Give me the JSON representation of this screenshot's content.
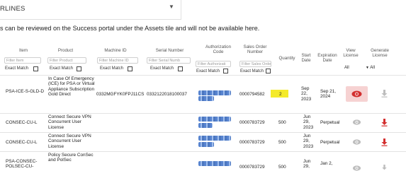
{
  "top_select": {
    "value": "RLINES"
  },
  "notice": "s can be reviewed on the Success portal under the Assets tile and will not be available here.",
  "columns": {
    "item": "Item",
    "product": "Product",
    "machine_id": "Machine ID",
    "serial_number": "Serial Number",
    "authorization_code": "Authorization Code",
    "sales_order_number": "Sales Order Number",
    "quantity": "Quantity",
    "start_date": "Start Date",
    "expiration_date": "Expiration Date",
    "view_license": "View License",
    "generate_license": "Generate License"
  },
  "filters": {
    "item_placeholder": "Filter Item",
    "product_placeholder": "Filter Product",
    "machine_id_placeholder": "Filter Machine ID",
    "serial_number_placeholder": "Filter Serial Numb",
    "authorization_placeholder": "Filter Authorizati",
    "sales_order_placeholder": "Filter Sales Order",
    "exact_match": "Exact Match",
    "view_select": "All",
    "generate_select": "All"
  },
  "rows": [
    {
      "item": "PSA-ICE-S-GLD-D",
      "product": "In Case Of Emergency (ICE) for PSA or Virtual Appliance Subscription Gold Direct",
      "machine_id": "0332MGFYK0FPJ11CS",
      "serial_number": "0332122018100037",
      "sales_order": "0000794582",
      "quantity": "2",
      "start_date": "Sep 22, 2023",
      "expiration_date": "Sep 21, 2024"
    },
    {
      "item": "CONSEC-CU-L",
      "product": "Connect Secure VPN Concurrent User License",
      "machine_id": "",
      "serial_number": "",
      "sales_order": "0000783729",
      "quantity": "500",
      "start_date": "Jun 29, 2023",
      "expiration_date": "Perpetual"
    },
    {
      "item": "CONSEC-CU-L",
      "product": "Connect Secure VPN Concurrent User License",
      "machine_id": "",
      "serial_number": "",
      "sales_order": "0000783729",
      "quantity": "500",
      "start_date": "Jun 29, 2023",
      "expiration_date": "Perpetual"
    },
    {
      "item": "PSA-CONSEC-POLSEC-CU-",
      "product": "Policy Secure ConSec and PolSec",
      "machine_id": "",
      "serial_number": "",
      "sales_order": "0000783729",
      "quantity": "500",
      "start_date": "Jun 29,",
      "expiration_date": "Jan 2,"
    }
  ],
  "icons": {
    "caret": "caret-down-icon",
    "view": "eye-icon",
    "download": "download-icon"
  },
  "colors": {
    "highlight": "#f4ea2a",
    "view_active_bg": "#f6d2d2",
    "view_active": "#d32f2f",
    "download_active": "#d32f2f",
    "icon_muted": "#bdbdbd"
  }
}
